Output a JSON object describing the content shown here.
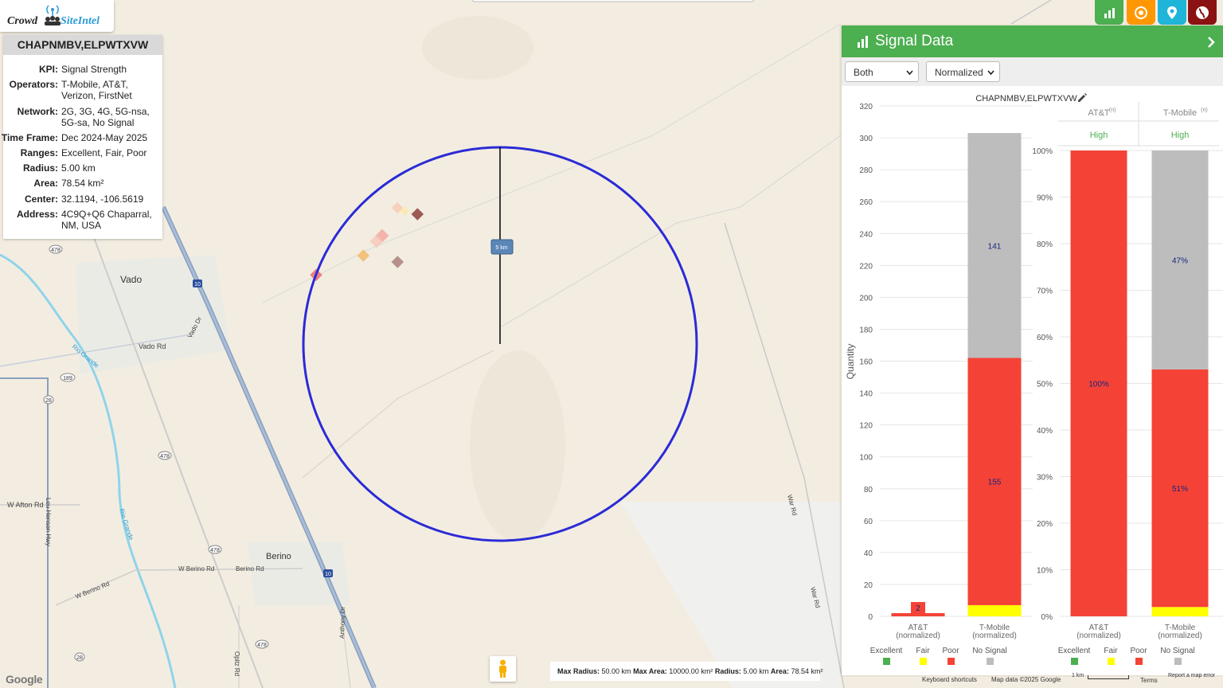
{
  "brand": {
    "part1": "Crowd",
    "part2": "SiteIntel"
  },
  "info": {
    "title": "CHAPNMBV,ELPWTXVW",
    "rows": [
      {
        "key": "KPI:",
        "value": "Signal Strength"
      },
      {
        "key": "Operators:",
        "value": "T-Mobile, AT&T, Verizon, FirstNet"
      },
      {
        "key": "Network:",
        "value": "2G, 3G, 4G, 5G-nsa, 5G-sa, No Signal"
      },
      {
        "key": "Time Frame:",
        "value": "Dec 2024-May 2025"
      },
      {
        "key": "Ranges:",
        "value": "Excellent, Fair, Poor"
      },
      {
        "key": "Radius:",
        "value": "5.00 km"
      },
      {
        "key": "Area:",
        "value": "78.54 km²"
      },
      {
        "key": "Center:",
        "value": "32.1194, -106.5619"
      },
      {
        "key": "Address:",
        "value": "4C9Q+Q6 Chaparral, NM, USA"
      }
    ]
  },
  "map_labels": {
    "vado": "Vado",
    "vado_rd": "Vado Rd",
    "vado_dr": "Vado Dr",
    "rio_grande": "Rio Grande",
    "w_afton_rd": "W Afton Rd",
    "lou_henson": "Lou Henson Hwy",
    "berino": "Berino",
    "w_berino_rd": "W Berino Rd",
    "berino_rd": "Berino Rd",
    "war_rd": "War Rd",
    "opitz_rd": "Opitz Rd",
    "anthony_dr": "Anthony Dr",
    "h478": "478",
    "h189": "189",
    "h28": "28",
    "i10": "10"
  },
  "radius_label": "5 km",
  "panel": {
    "title": "Signal Data",
    "select_operator": "Both",
    "select_mode": "Normalized",
    "chart_title": "CHAPNMBV,ELPWTXVW"
  },
  "chart_data": [
    {
      "type": "bar",
      "title": "CHAPNMBV,ELPWTXVW",
      "ylabel": "Quantity",
      "ylim": [
        0,
        320
      ],
      "yticks": [
        0,
        20,
        40,
        60,
        80,
        100,
        120,
        140,
        160,
        180,
        200,
        220,
        240,
        260,
        280,
        300,
        320
      ],
      "categories": [
        "AT&T (normalized)",
        "T-Mobile (normalized)"
      ],
      "category_lines": [
        [
          "AT&T",
          "(normalized)"
        ],
        [
          "T-Mobile",
          "(normalized)"
        ]
      ],
      "stacked": true,
      "series": [
        {
          "name": "Excellent",
          "color": "#4caf50",
          "values": [
            0,
            0
          ]
        },
        {
          "name": "Fair",
          "color": "#ffff00",
          "values": [
            0,
            7
          ]
        },
        {
          "name": "Poor",
          "color": "#f44336",
          "values": [
            2,
            155
          ]
        },
        {
          "name": "No Signal",
          "color": "#bdbdbd",
          "values": [
            0,
            141
          ]
        }
      ],
      "data_labels": [
        {
          "category": 0,
          "series": "Poor",
          "text": "2"
        },
        {
          "category": 1,
          "series": "Poor",
          "text": "155"
        },
        {
          "category": 1,
          "series": "No Signal",
          "text": "141"
        }
      ],
      "legend": [
        "Excellent",
        "Fair",
        "Poor",
        "No Signal"
      ],
      "legend_position": "bottom"
    },
    {
      "type": "bar",
      "ylim": [
        0,
        100
      ],
      "yticks": [
        "0%",
        "10%",
        "20%",
        "30%",
        "40%",
        "50%",
        "60%",
        "70%",
        "80%",
        "90%",
        "100%"
      ],
      "categories": [
        "AT&T (normalized)",
        "T-Mobile (normalized)"
      ],
      "category_lines": [
        [
          "AT&T",
          "(normalized)"
        ],
        [
          "T-Mobile",
          "(normalized)"
        ]
      ],
      "stacked": true,
      "percent": true,
      "headers": [
        {
          "label": "AT&T",
          "sup": "(n)",
          "rating": "High"
        },
        {
          "label": "T-Mobile",
          "sup": "(n)",
          "rating": "High"
        }
      ],
      "series": [
        {
          "name": "Excellent",
          "color": "#4caf50",
          "values": [
            0,
            0
          ]
        },
        {
          "name": "Fair",
          "color": "#ffff00",
          "values": [
            0,
            2
          ]
        },
        {
          "name": "Poor",
          "color": "#f44336",
          "values": [
            100,
            51
          ]
        },
        {
          "name": "No Signal",
          "color": "#bdbdbd",
          "values": [
            0,
            47
          ]
        }
      ],
      "data_labels": [
        {
          "category": 0,
          "series": "Poor",
          "text": "100%"
        },
        {
          "category": 1,
          "series": "Poor",
          "text": "51%"
        },
        {
          "category": 1,
          "series": "No Signal",
          "text": "47%"
        }
      ],
      "legend": [
        "Excellent",
        "Fair",
        "Poor",
        "No Signal"
      ],
      "legend_position": "bottom"
    }
  ],
  "status": {
    "max_radius_label": "Max Radius:",
    "max_radius": "50.00 km",
    "max_area_label": "Max Area:",
    "max_area": "10000.00 km²",
    "radius_label": "Radius:",
    "radius": "5.00 km",
    "area_label": "Area:",
    "area": "78.54 km²"
  },
  "footer": {
    "google": "Google",
    "shortcuts": "Keyboard shortcuts",
    "map_data": "Map data ©2025 Google",
    "scale": "1 km",
    "terms": "Terms",
    "report": "Report a map error"
  }
}
